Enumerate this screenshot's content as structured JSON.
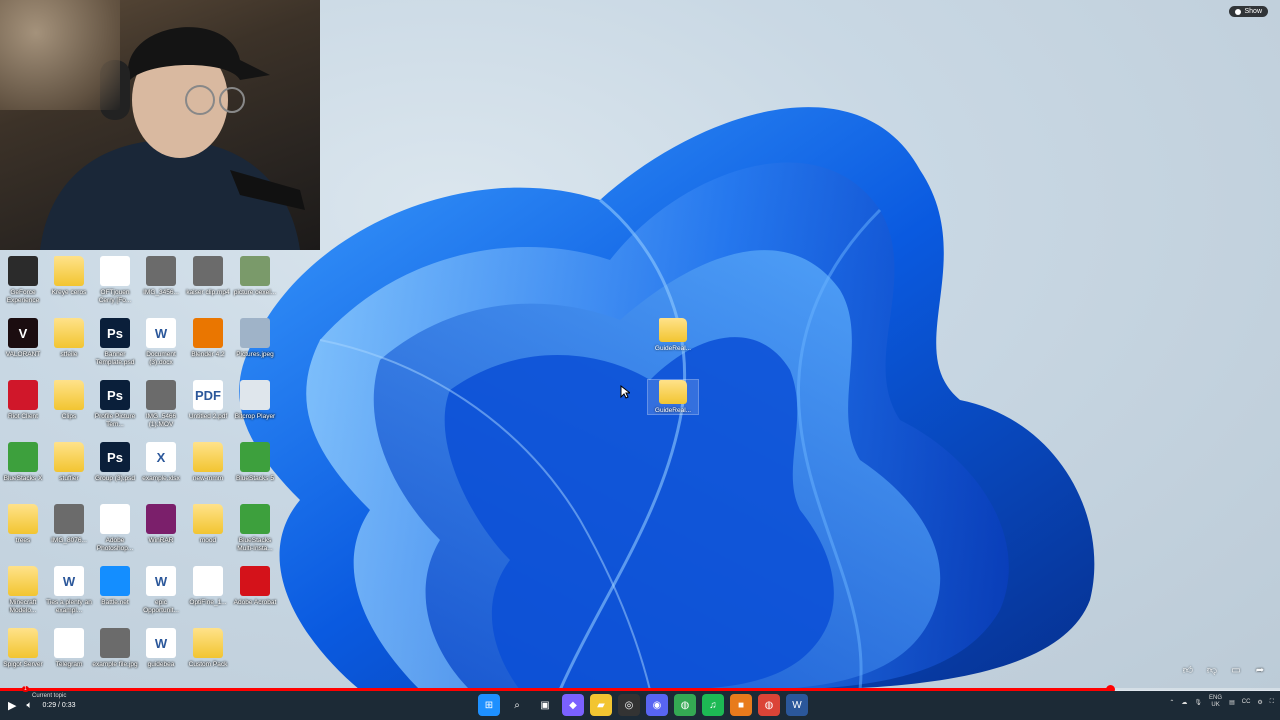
{
  "badge": {
    "label": "Show"
  },
  "player": {
    "time": "0:29 / 0:33",
    "chapter": "Current topic",
    "progress": 0.867
  },
  "tray": {
    "lang_top": "ENG",
    "lang_bottom": "UK"
  },
  "desktop_icons": [
    {
      "label": "GeForce Experience",
      "icon": "nvidia-icon",
      "color": "#2b2b2b",
      "text": ""
    },
    {
      "label": "Kreye ceros",
      "icon": "folder-icon",
      "color": "folder",
      "text": ""
    },
    {
      "label": "OFTjouen Cerry [Fo...",
      "icon": "media-icon",
      "color": "#ffffff",
      "text": ""
    },
    {
      "label": "IMG_3456...",
      "icon": "photo-icon",
      "color": "#6b6b6b",
      "text": ""
    },
    {
      "label": "kaiser clip.mp4",
      "icon": "video-icon",
      "color": "#6b6b6b",
      "text": ""
    },
    {
      "label": "picture oexel...",
      "icon": "image-icon",
      "color": "#7a9a6a",
      "text": ""
    },
    {
      "label": "VALORANT",
      "icon": "valorant-icon",
      "color": "#1b0d10",
      "text": "V"
    },
    {
      "label": "stfeile",
      "icon": "folder-icon",
      "color": "folder",
      "text": ""
    },
    {
      "label": "Banner Template.psd",
      "icon": "photoshop-icon",
      "color": "#0a1f3a",
      "text": "Ps"
    },
    {
      "label": "Document (3).docx",
      "icon": "word-icon",
      "color": "#ffffff",
      "text": "W"
    },
    {
      "label": "Blender 4.2",
      "icon": "blender-icon",
      "color": "#ea7600",
      "text": ""
    },
    {
      "label": "Pictures.jpeg",
      "icon": "image-icon",
      "color": "#9fb3c8",
      "text": ""
    },
    {
      "label": "Riot Client",
      "icon": "riot-icon",
      "color": "#d0172a",
      "text": ""
    },
    {
      "label": "Clips",
      "icon": "folder-icon",
      "color": "folder",
      "text": ""
    },
    {
      "label": "Profile Picture Tem...",
      "icon": "photoshop-icon",
      "color": "#0a1f3a",
      "text": "Ps"
    },
    {
      "label": "IMG_5466 (1).MOV",
      "icon": "video-icon",
      "color": "#6b6b6b",
      "text": ""
    },
    {
      "label": "Untitled 2.pdf",
      "icon": "pdf-icon",
      "color": "#ffffff",
      "text": "PDF"
    },
    {
      "label": "Bitcrop Player",
      "icon": "player-icon",
      "color": "#dfe6ec",
      "text": ""
    },
    {
      "label": "BlueStacks X",
      "icon": "bluestacks-icon",
      "color": "#3da03d",
      "text": ""
    },
    {
      "label": "stuffier",
      "icon": "folder-icon",
      "color": "folder",
      "text": ""
    },
    {
      "label": "Group (3).psd",
      "icon": "photoshop-icon",
      "color": "#0a1f3a",
      "text": "Ps"
    },
    {
      "label": "example.xlsx",
      "icon": "excel-icon",
      "color": "#ffffff",
      "text": "X"
    },
    {
      "label": "new-mmm",
      "icon": "folder-icon",
      "color": "folder",
      "text": ""
    },
    {
      "label": "BlueStacks 5",
      "icon": "bluestacks-icon",
      "color": "#3da03d",
      "text": ""
    },
    {
      "label": "trees",
      "icon": "folder-icon",
      "color": "folder",
      "text": ""
    },
    {
      "label": "IMG_8076...",
      "icon": "photo-icon",
      "color": "#6b6b6b",
      "text": ""
    },
    {
      "label": "Adobe Photoshop...",
      "icon": "adobe-icon",
      "color": "#ffffff",
      "text": ""
    },
    {
      "label": "WinRAR",
      "icon": "winrar-icon",
      "color": "#7b1f6b",
      "text": ""
    },
    {
      "label": "mood",
      "icon": "folder-icon",
      "color": "folder",
      "text": ""
    },
    {
      "label": "BlueStacks Multi-Insta...",
      "icon": "bluestacks-icon",
      "color": "#3da03d",
      "text": ""
    },
    {
      "label": "Minecraft Modelo...",
      "icon": "folder-icon",
      "color": "folder",
      "text": ""
    },
    {
      "label": "Ties a plenty an exampl...",
      "icon": "word-icon",
      "color": "#ffffff",
      "text": "W"
    },
    {
      "label": "Battle.net",
      "icon": "battlenet-icon",
      "color": "#148eff",
      "text": ""
    },
    {
      "label": "epic Opportunit...",
      "icon": "word-icon",
      "color": "#ffffff",
      "text": "W"
    },
    {
      "label": "OptiFine_1...",
      "icon": "java-icon",
      "color": "#ffffff",
      "text": ""
    },
    {
      "label": "Adobe Acrobat",
      "icon": "acrobat-icon",
      "color": "#d4121a",
      "text": ""
    },
    {
      "label": "Spigot Server",
      "icon": "folder-icon",
      "color": "folder",
      "text": ""
    },
    {
      "label": "Telegram",
      "icon": "telegram-icon",
      "color": "#ffffff",
      "text": ""
    },
    {
      "label": "example file.jpg",
      "icon": "image-icon",
      "color": "#6b6b6b",
      "text": ""
    },
    {
      "label": "guidebea",
      "icon": "word-icon",
      "color": "#ffffff",
      "text": "W"
    },
    {
      "label": "Custom Pack",
      "icon": "folder-icon",
      "color": "folder",
      "text": ""
    }
  ],
  "floating_folders": [
    {
      "label": "GuideReal..."
    },
    {
      "label": "GuideReal..."
    }
  ],
  "taskbar": [
    {
      "icon": "windows-start-icon",
      "color": "#1e90ff",
      "text": "⊞"
    },
    {
      "icon": "search-icon",
      "color": "transparent",
      "text": "⌕"
    },
    {
      "icon": "task-view-icon",
      "color": "transparent",
      "text": "▣"
    },
    {
      "icon": "copilot-icon",
      "color": "#7b61ff",
      "text": "◆"
    },
    {
      "icon": "file-explorer-icon",
      "color": "#f2c531",
      "text": "▰"
    },
    {
      "icon": "obs-icon",
      "color": "#333333",
      "text": "◎"
    },
    {
      "icon": "discord-icon",
      "color": "#5865f2",
      "text": "◉"
    },
    {
      "icon": "chrome-icon",
      "color": "#34a853",
      "text": "◍"
    },
    {
      "icon": "spotify-icon",
      "color": "#1db954",
      "text": "♫"
    },
    {
      "icon": "app-icon",
      "color": "#e87b1c",
      "text": "■"
    },
    {
      "icon": "chrome-alt-icon",
      "color": "#db4437",
      "text": "◍"
    },
    {
      "icon": "word-taskbar-icon",
      "color": "#2b579a",
      "text": "W"
    }
  ]
}
